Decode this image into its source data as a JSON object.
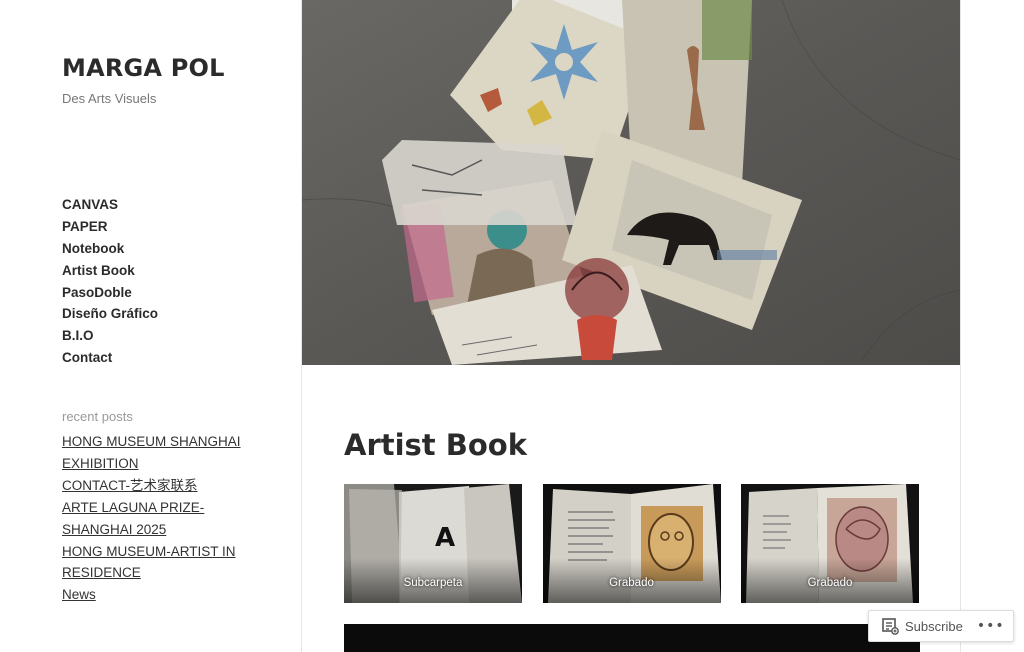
{
  "site": {
    "title": "MARGA POL",
    "description": "Des Arts Visuels"
  },
  "nav": {
    "items": [
      "CANVAS",
      "PAPER",
      "Notebook",
      "Artist Book",
      "PasoDoble",
      "Diseño Gráfico",
      "B.I.O",
      "Contact"
    ]
  },
  "recent_posts": {
    "title": "recent posts",
    "items": [
      "HONG MUSEUM SHANGHAI EXHIBITION",
      "CONTACT-艺术家联系",
      "ARTE LAGUNA PRIZE- SHANGHAI 2025",
      "HONG MUSEUM-ARTIST IN RESIDENCE",
      "News"
    ]
  },
  "page": {
    "title": "Artist Book"
  },
  "gallery": {
    "items": [
      {
        "caption": "Subcarpeta",
        "letter": "A"
      },
      {
        "caption": "Grabado"
      },
      {
        "caption": "Grabado"
      }
    ]
  },
  "subscribe": {
    "label": "Subscribe",
    "more": "•••"
  }
}
